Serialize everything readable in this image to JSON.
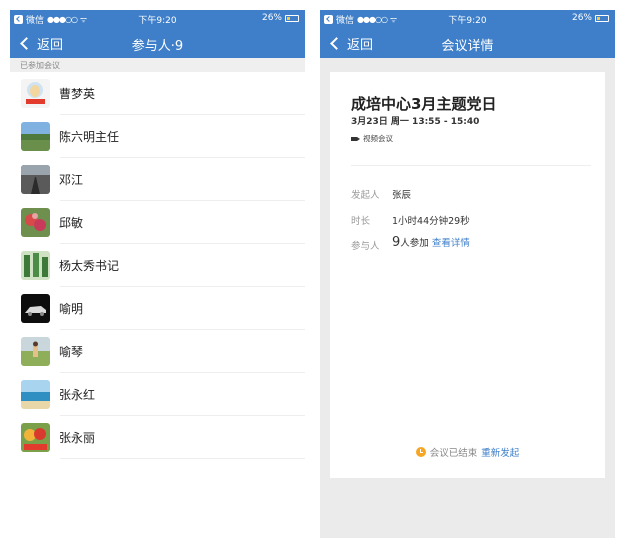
{
  "left_screen": {
    "status_bar": {
      "app": "微信",
      "signal": "●●●○○",
      "time": "下午9:20",
      "battery": "26%",
      "battery_level": 0.26
    },
    "nav": {
      "back_label": "返回",
      "title": "参与人·9"
    },
    "section_header": "已参加会议",
    "participants": [
      {
        "name": "曹梦英",
        "avatar": "avatar-cartoon"
      },
      {
        "name": "陈六明主任",
        "avatar": "avatar-landscape"
      },
      {
        "name": "邓江",
        "avatar": "avatar-road"
      },
      {
        "name": "邱敏",
        "avatar": "avatar-flowers"
      },
      {
        "name": "杨太秀书记",
        "avatar": "avatar-trees"
      },
      {
        "name": "喻明",
        "avatar": "avatar-car"
      },
      {
        "name": "喻琴",
        "avatar": "avatar-person-field"
      },
      {
        "name": "张永红",
        "avatar": "avatar-sea"
      },
      {
        "name": "张永丽",
        "avatar": "avatar-fruits"
      }
    ]
  },
  "right_screen": {
    "status_bar": {
      "app": "微信",
      "signal": "●●●○○",
      "time": "下午9:20",
      "battery": "26%",
      "battery_level": 0.26
    },
    "nav": {
      "back_label": "返回",
      "title": "会议详情"
    },
    "meeting": {
      "title": "成培中心3月主题党日",
      "time": "3月23日 周一 13:55 - 15:40",
      "type": "视频会议",
      "initiator_label": "发起人",
      "initiator": "张辰",
      "duration_label": "时长",
      "duration": "1小时44分钟29秒",
      "participants_label": "参与人",
      "participants_count": "9",
      "participants_suffix": "人参加",
      "view_details": "查看详情",
      "ended_text": "会议已结束",
      "restart": "重新发起"
    }
  },
  "colors": {
    "accent": "#3f7fc9",
    "warning": "#f5a623"
  }
}
